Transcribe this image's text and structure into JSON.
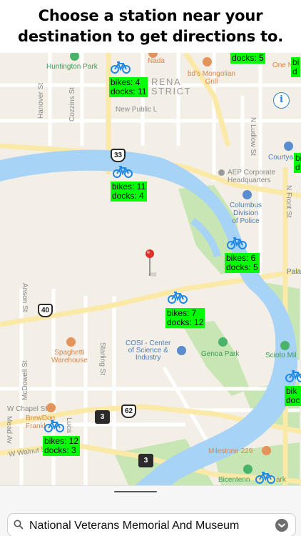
{
  "header": {
    "line1": "Choose a station near your",
    "line2": "destination to get directions to."
  },
  "map": {
    "labels": {
      "huntington_park": "Huntington Park",
      "nada": "Nada",
      "arena_district": "RENA\nSTRICT",
      "bds": "bd's Mongolian\nGrill",
      "one_n": "One N",
      "new_public": "New Public L",
      "hanover": "Hanover St",
      "cozzins": "Cozzins St",
      "ludlow": "N Ludlow St",
      "courtyard": "Courtya",
      "aep": "AEP Corporate\nHeadquarters",
      "columbus_police": "Columbus\nDivision\nof Police",
      "front_st": "N Front St",
      "pala": "Pala",
      "anson": "Anson St",
      "spaghetti": "Spaghetti\nWarehouse",
      "mcdowell": "McDowell St",
      "starling": "Starling St",
      "cosi": "COSI - Center\nof Science &\nIndustry",
      "genoa": "Genoa Park",
      "scioto": "Scioto Mil",
      "w_chapel": "W Chapel St",
      "brewdog": "BrewDog\nFrankl",
      "mead": "Mead Av",
      "lucas": "Luca",
      "w_walnut": "W Walnut St",
      "milestone": "Milestone 229",
      "bicentennial": "Bicentenn",
      "park_suffix": "ark"
    },
    "shields": {
      "r33": "33",
      "r40": "40",
      "r62": "62",
      "r3a": "3",
      "r3b": "3"
    },
    "stations": [
      {
        "text": "docks: 5"
      },
      {
        "text": "bikes: 4\ndocks: 11"
      },
      {
        "text": "bikes: 11\ndocks: 4"
      },
      {
        "text": "bikes: 6\ndocks: 5"
      },
      {
        "text": "bikes: 7\ndocks: 12"
      },
      {
        "text": "bikes: 12\ndocks: 3"
      },
      {
        "text": "bi\nd"
      },
      {
        "text": "bi\nd"
      },
      {
        "text": "bik\ndoc"
      }
    ],
    "info_label": "i"
  },
  "search": {
    "value": "National Veterans Memorial And Museum"
  },
  "colors": {
    "station_box": "#00ff00",
    "bike_icon": "#1e88e5",
    "river": "#a7d3f6",
    "park": "#c8e6b4",
    "road": "#fbe9a8",
    "info": "#2a7fe0",
    "pin": "#e0302a"
  }
}
